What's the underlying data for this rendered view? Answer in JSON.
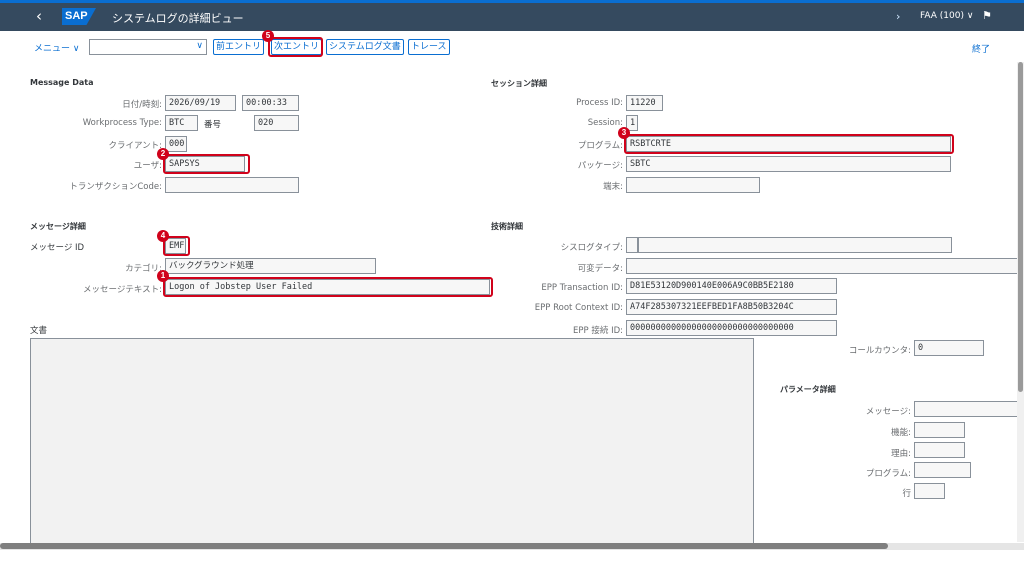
{
  "shell": {
    "title": "システムログの詳細ビュー",
    "logo": "SAP",
    "client": "FAA (100) ∨",
    "back_icon": "chevron-left-icon",
    "nav_icon": "chevron-right-icon"
  },
  "toolbar": {
    "menu_label": "メニュー ∨",
    "combo_value": "",
    "prev_entry": "前エントリ",
    "next_entry": "次エントリ",
    "syslog_doc": "システムログ文書",
    "trace": "トレース",
    "end": "終了"
  },
  "message_data": {
    "title": "Message Data",
    "date_time_label": "日付/時刻:",
    "date": "2026/09/19",
    "time": "00:00:33",
    "wp_type_label": "Workprocess Type:",
    "wp_type": "BTC",
    "number_label": "番号",
    "number": "020",
    "client_label": "クライアント:",
    "client": "000",
    "user_label": "ユーザ:",
    "user": "SAPSYS",
    "tcode_label": "トランザクションCode:",
    "tcode": ""
  },
  "session": {
    "title": "セッション詳細",
    "process_id_label": "Process ID:",
    "process_id": "11220",
    "session_label": "Session:",
    "session": "1",
    "program_label": "プログラム:",
    "program": "RSBTCRTE",
    "package_label": "パッケージ:",
    "package": "SBTC",
    "terminal_label": "端末:",
    "terminal": ""
  },
  "message_detail": {
    "title": "メッセージ詳細",
    "message_id_label": "メッセージ ID",
    "message_id": "EMF",
    "category_label": "カテゴリ:",
    "category": "バックグラウンド処理",
    "message_text_label": "メッセージテキスト:",
    "message_text": "Logon of Jobstep User Failed"
  },
  "tech": {
    "title": "技術詳細",
    "syslog_type_label": "シスログタイプ:",
    "syslog_type": "",
    "variable_data_label": "可変データ:",
    "variable_data": "",
    "epp_tx_label": "EPP Transaction ID:",
    "epp_tx": "D81E53120D900140E006A9C0BB5E2180",
    "epp_root_label": "EPP Root Context ID:",
    "epp_root": "A74F285307321EEFBED1FA8B50B3204C",
    "epp_conn_label": "EPP 接続 ID:",
    "epp_conn": "00000000000000000000000000000000",
    "call_counter_label": "コールカウンタ:",
    "call_counter": "0"
  },
  "document": {
    "title": "文書"
  },
  "params": {
    "title": "パラメータ詳細",
    "message_label": "メッセージ:",
    "function_label": "機能:",
    "reason_label": "理由:",
    "program_label": "プログラム:",
    "line_label": "行"
  },
  "annotations": {
    "b1": "1",
    "b2": "2",
    "b3": "3",
    "b4": "4",
    "b5": "5"
  },
  "colors": {
    "shell": "#354a5f",
    "accent": "#0a6ed1",
    "highlight": "#d0021b"
  }
}
